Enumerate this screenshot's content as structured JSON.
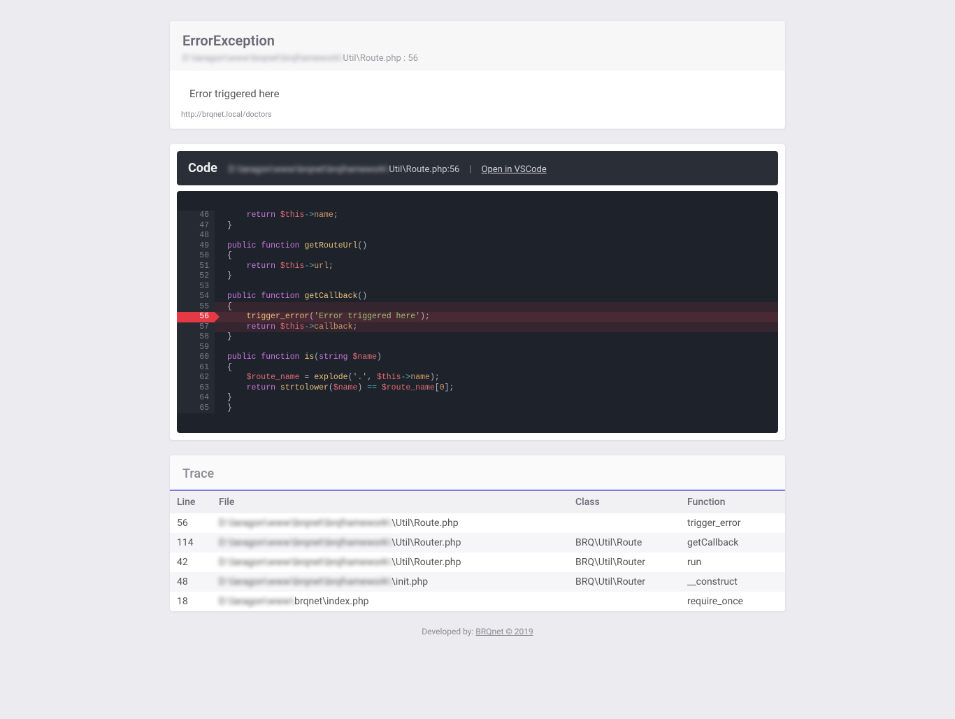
{
  "header": {
    "exception_title": "ErrorException",
    "path_blurred": "D:\\laragon\\www\\brqnet\\brqframework\\",
    "path_visible": "Util\\Route.php : 56",
    "message": "Error triggered here",
    "url": "http://brqnet.local/doctors"
  },
  "code": {
    "label": "Code",
    "path_blurred": "D:\\laragon\\www\\brqnet\\brqframework\\",
    "path_visible": "Util\\Route.php:56",
    "separator": "|",
    "open_label": "Open in VSCode",
    "highlight_line": 56,
    "lines": [
      {
        "n": 46
      },
      {
        "n": 47
      },
      {
        "n": 48
      },
      {
        "n": 49
      },
      {
        "n": 50
      },
      {
        "n": 51
      },
      {
        "n": 52
      },
      {
        "n": 53
      },
      {
        "n": 54
      },
      {
        "n": 55
      },
      {
        "n": 56
      },
      {
        "n": 57
      },
      {
        "n": 58
      },
      {
        "n": 59
      },
      {
        "n": 60
      },
      {
        "n": 61
      },
      {
        "n": 62
      },
      {
        "n": 63
      },
      {
        "n": 64
      },
      {
        "n": 65
      }
    ],
    "src": {
      "l46": "    return $this->name;",
      "l47": "}",
      "l49a": "public",
      "l49b": "function",
      "l49c": "getRouteUrl",
      "l51": "    return $this->url;",
      "l54a": "public",
      "l54b": "function",
      "l54c": "getCallback",
      "l56a": "    trigger_error(",
      "l56b": "'Error triggered here'",
      "l56c": ");",
      "l57": "    return $this->callback;",
      "l60a": "public",
      "l60b": "function",
      "l60c": "is",
      "l60d": "string",
      "l60e": "$name",
      "l62a": "    $route_name",
      "l62b": " = ",
      "l62c": "explode",
      "l62d": "'.'",
      "l62e": "$this",
      "l62f": "name",
      "l63a": "    return ",
      "l63b": "strtolower",
      "l63c": "$name",
      "l63d": " == ",
      "l63e": "$route_name",
      "l63f": "0"
    }
  },
  "trace": {
    "title": "Trace",
    "columns": {
      "line": "Line",
      "file": "File",
      "class": "Class",
      "function": "Function"
    },
    "rows": [
      {
        "line": "56",
        "file_blur": "D:\\laragon\\www\\brqnet\\brqframework\\",
        "file_vis": "\\Util\\Route.php",
        "class": "",
        "function": "trigger_error"
      },
      {
        "line": "114",
        "file_blur": "D:\\laragon\\www\\brqnet\\brqframework\\",
        "file_vis": "\\Util\\Router.php",
        "class": "BRQ\\Util\\Route",
        "function": "getCallback"
      },
      {
        "line": "42",
        "file_blur": "D:\\laragon\\www\\brqnet\\brqframework\\",
        "file_vis": "\\Util\\Router.php",
        "class": "BRQ\\Util\\Router",
        "function": "run"
      },
      {
        "line": "48",
        "file_blur": "D:\\laragon\\www\\brqnet\\brqframework\\",
        "file_vis": "\\init.php",
        "class": "BRQ\\Util\\Router",
        "function": "__construct"
      },
      {
        "line": "18",
        "file_blur": "D:\\laragon\\www\\",
        "file_vis": "brqnet\\index.php",
        "class": "",
        "function": "require_once"
      }
    ]
  },
  "footer": {
    "prefix": "Developed by: ",
    "link_text": "BRQnet © 2019"
  }
}
